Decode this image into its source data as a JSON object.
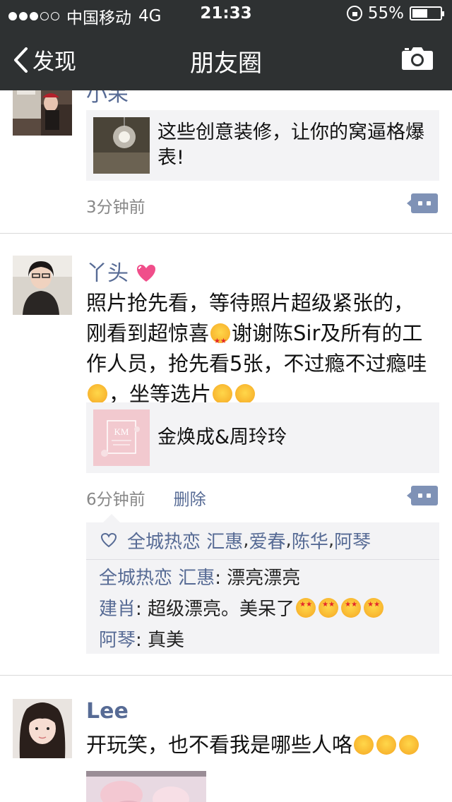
{
  "status_bar": {
    "carrier": "中国移动",
    "network": "4G",
    "time": "21:33",
    "battery": "55%",
    "battery_level": 0.55
  },
  "nav": {
    "back_label": "发现",
    "title": "朋友圈"
  },
  "posts": [
    {
      "author": "小呆",
      "link_text": "这些创意装修，让你的窝逼格爆表!",
      "time": "3分钟前"
    },
    {
      "author": "丫头",
      "text_l1": "照片抢先看，等待照片超级紧张的，",
      "text_l2a": "刚看到超惊喜",
      "text_l2b": "谢谢陈Sir及所有的工",
      "text_l3": "作人员，抢先看5张，不过瘾不过瘾哇",
      "text_l4": "，坐等选片",
      "link_text": "金焕成&周玲玲",
      "time": "6分钟前",
      "delete_label": "删除",
      "likes": [
        "全城热恋 汇惠",
        "爱春",
        "陈华",
        "阿琴"
      ],
      "like_sep": ", ",
      "comments": [
        {
          "name": "全城热恋 汇惠",
          "text": "漂亮漂亮"
        },
        {
          "name": "建肖",
          "text": "超级漂亮。美呆了"
        },
        {
          "name": "阿琴",
          "text": "真美"
        }
      ],
      "colon": ": "
    },
    {
      "author": "Lee",
      "text": "开玩笑，也不看我是哪些人咯"
    }
  ],
  "colors": {
    "nav_bg": "#2e3132",
    "name_blue": "#576b95",
    "card_bg": "#f3f3f5"
  }
}
